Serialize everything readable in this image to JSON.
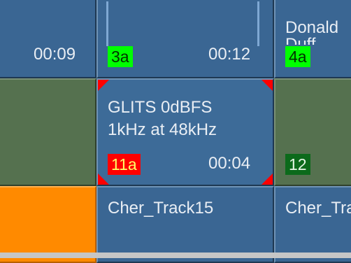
{
  "cells": {
    "r1c1": {
      "time": "00:09"
    },
    "r1c2": {
      "badge": "3a",
      "time": "00:12"
    },
    "r1c3": {
      "title": "Donald",
      "subtitle": "Duff",
      "badge": "4a"
    },
    "r2c2": {
      "line1": "GLITS 0dBFS",
      "line2": "1kHz at 48kHz",
      "badge": "11a",
      "time": "00:04"
    },
    "r2c3": {
      "badge": "12"
    },
    "r3c2": {
      "title": "Cher_Track15"
    },
    "r3c3": {
      "title": "Cher_Track"
    }
  },
  "colors": {
    "tile_blue": "#3a6693",
    "tile_green": "#55714f",
    "tile_orange": "#ff8a00",
    "badge_bright_green": "#00ff00",
    "badge_dark_green": "#0c6a1b",
    "badge_red": "#ff0000",
    "corner_marker_red": "#ff0000"
  }
}
